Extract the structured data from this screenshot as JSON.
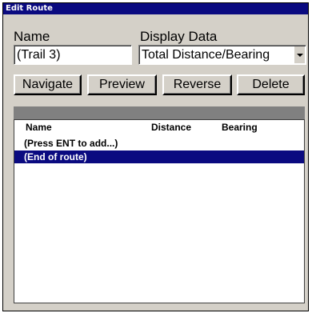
{
  "window": {
    "title": "Edit Route"
  },
  "form": {
    "name_label": "Name",
    "name_value": "(Trail 3)",
    "display_label": "Display Data",
    "display_value": "Total Distance/Bearing"
  },
  "buttons": {
    "navigate": "Navigate",
    "preview": "Preview",
    "reverse": "Reverse",
    "delete": "Delete"
  },
  "list": {
    "columns": [
      "Name",
      "Distance",
      "Bearing"
    ],
    "rows": [
      "(Press ENT to add...)",
      "(End of route)"
    ],
    "selected_index": 1
  },
  "colors": {
    "titlebar": "#0a0a80",
    "selection": "#0a0a80",
    "panel": "#d4d0c8"
  }
}
